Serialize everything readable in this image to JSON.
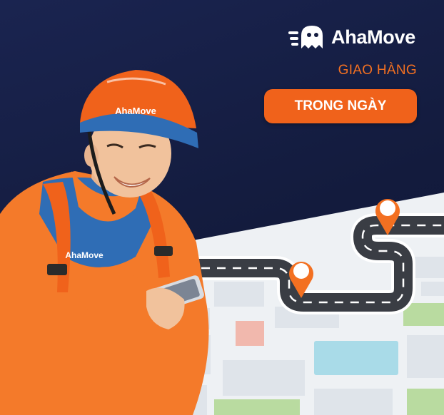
{
  "brand": {
    "name": "AhaMove",
    "logo_icon": "ahamove-ghost-logo-icon"
  },
  "tagline": "GIAO HÀNG",
  "cta": {
    "label": "TRONG NGÀY"
  },
  "courier": {
    "helmet_logo_text": "AhaMove",
    "jacket_logo_text": "AhaMove"
  },
  "colors": {
    "background": "#141c40",
    "accent": "#f37021",
    "cta": "#f0621b",
    "road": "#3a3d44",
    "map_road": "#ffffff",
    "map_block": "#dfe4ea",
    "map_green": "#b9dba0",
    "map_blue": "#a9dbe8",
    "map_red": "#f1b8ad"
  },
  "icons": [
    "ahamove-ghost-logo-icon",
    "map-pin-icon",
    "phone-icon"
  ]
}
